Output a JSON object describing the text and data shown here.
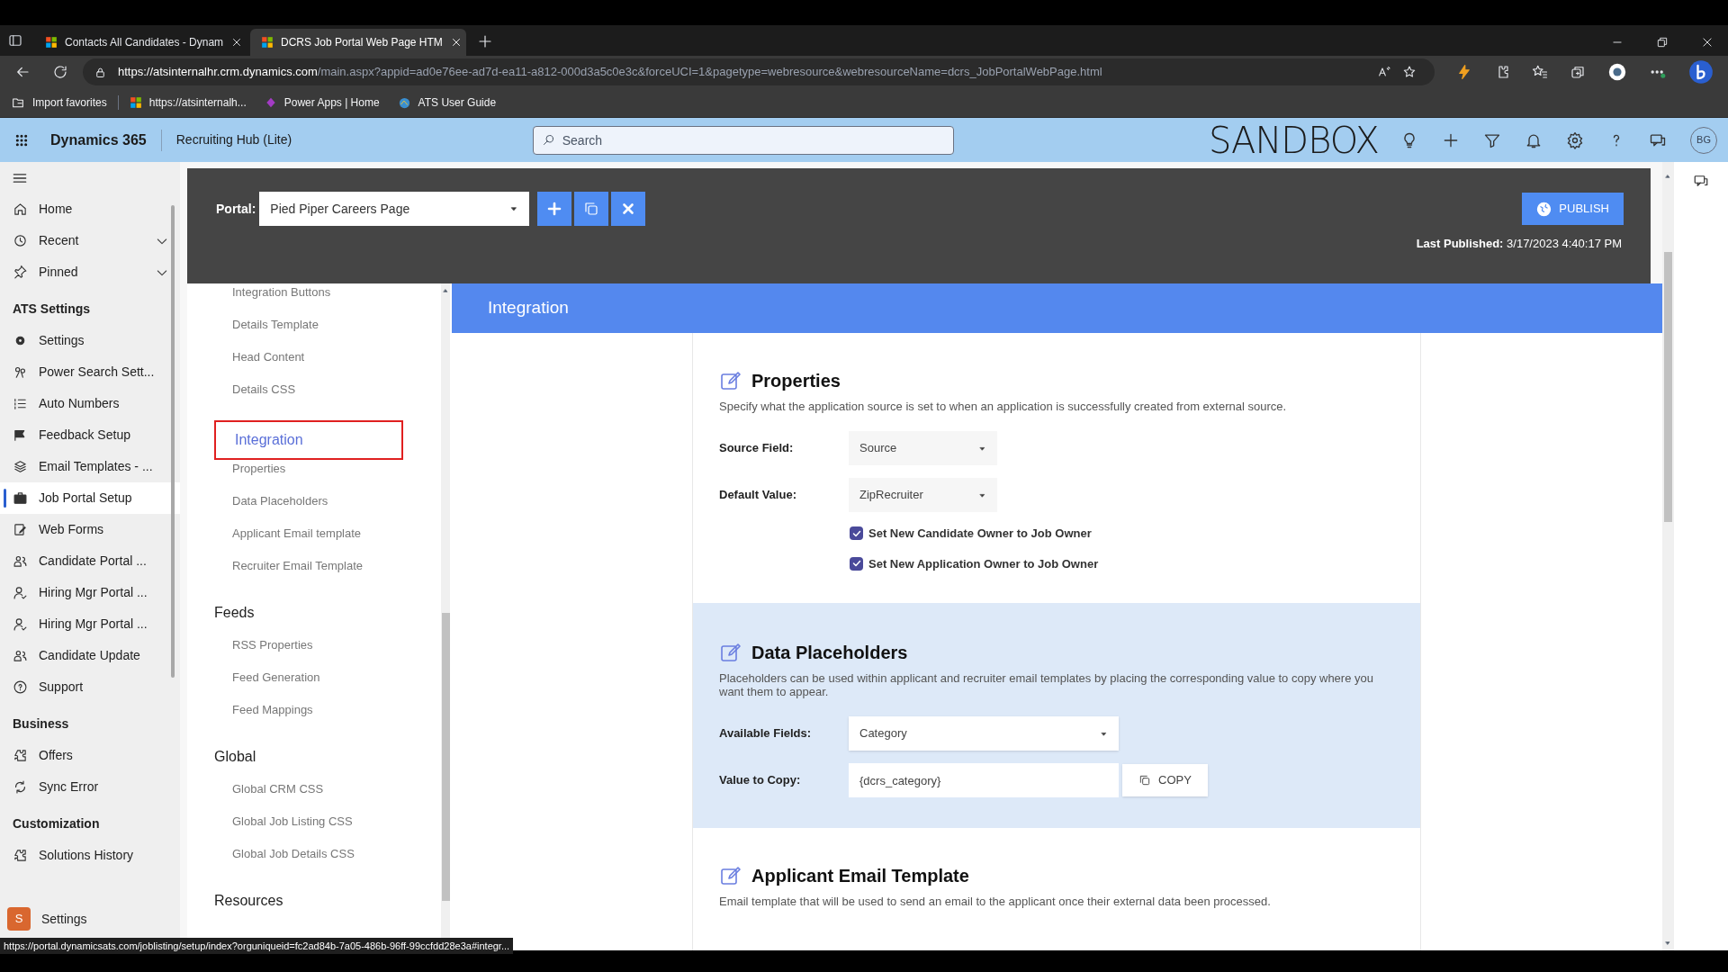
{
  "browser": {
    "tabs": [
      {
        "title": "Contacts All Candidates - Dynam",
        "selected": false
      },
      {
        "title": "DCRS Job Portal Web Page HTM",
        "selected": true
      }
    ],
    "url_host": "https://atsinternalhr.crm.dynamics.com",
    "url_rest": "/main.aspx?appid=ad0e76ee-ad7d-ea11-a812-000d3a5c0e3c&forceUCI=1&pagetype=webresource&webresourceName=dcrs_JobPortalWebPage.html",
    "bookmarks": [
      {
        "label": "Import favorites"
      },
      {
        "label": "https://atsinternalh..."
      },
      {
        "label": "Power Apps | Home"
      },
      {
        "label": "ATS User Guide"
      }
    ],
    "status_url": "https://portal.dynamicsats.com/joblisting/setup/index?orguniqueid=fc2ad84b-7a05-486b-96ff-99ccfdd28e3a#integr..."
  },
  "app_header": {
    "brand": "Dynamics 365",
    "app_name": "Recruiting Hub (Lite)",
    "search_placeholder": "Search",
    "environment": "SANDBOX",
    "avatar": "BG"
  },
  "sidebar": {
    "items": [
      {
        "kind": "item",
        "label": "Home",
        "selected": false,
        "expandable": false
      },
      {
        "kind": "item",
        "label": "Recent",
        "selected": false,
        "expandable": true
      },
      {
        "kind": "item",
        "label": "Pinned",
        "selected": false,
        "expandable": true
      },
      {
        "kind": "heading",
        "label": "ATS Settings"
      },
      {
        "kind": "item",
        "label": "Settings",
        "selected": false,
        "expandable": false
      },
      {
        "kind": "item",
        "label": "Power Search Sett...",
        "selected": false,
        "expandable": false
      },
      {
        "kind": "item",
        "label": "Auto Numbers",
        "selected": false,
        "expandable": false
      },
      {
        "kind": "item",
        "label": "Feedback Setup",
        "selected": false,
        "expandable": false
      },
      {
        "kind": "item",
        "label": "Email Templates - ...",
        "selected": false,
        "expandable": false
      },
      {
        "kind": "item",
        "label": "Job Portal Setup",
        "selected": true,
        "expandable": false
      },
      {
        "kind": "item",
        "label": "Web Forms",
        "selected": false,
        "expandable": false
      },
      {
        "kind": "item",
        "label": "Candidate Portal ...",
        "selected": false,
        "expandable": false
      },
      {
        "kind": "item",
        "label": "Hiring Mgr Portal ...",
        "selected": false,
        "expandable": false
      },
      {
        "kind": "item",
        "label": "Hiring Mgr Portal ...",
        "selected": false,
        "expandable": false
      },
      {
        "kind": "item",
        "label": "Candidate Update",
        "selected": false,
        "expandable": false
      },
      {
        "kind": "item",
        "label": "Support",
        "selected": false,
        "expandable": false
      },
      {
        "kind": "heading",
        "label": "Business"
      },
      {
        "kind": "item",
        "label": "Offers",
        "selected": false,
        "expandable": false
      },
      {
        "kind": "item",
        "label": "Sync Error",
        "selected": false,
        "expandable": false
      },
      {
        "kind": "heading",
        "label": "Customization"
      },
      {
        "kind": "item",
        "label": "Solutions History",
        "selected": false,
        "expandable": false
      }
    ],
    "area": {
      "badge": "S",
      "label": "Settings"
    }
  },
  "portal_bar": {
    "label": "Portal:",
    "value": "Pied Piper Careers Page",
    "publish": "PUBLISH",
    "last_published_label": "Last Published:",
    "last_published_value": "3/17/2023 4:40:17 PM"
  },
  "section_nav": [
    {
      "kind": "sub",
      "label": "Integration Buttons",
      "selected": false
    },
    {
      "kind": "sub",
      "label": "Details Template",
      "selected": false
    },
    {
      "kind": "sub",
      "label": "Head Content",
      "selected": false
    },
    {
      "kind": "sub",
      "label": "Details CSS",
      "selected": false
    },
    {
      "kind": "group",
      "label": "Integration",
      "selected": true
    },
    {
      "kind": "sub",
      "label": "Properties",
      "selected": false
    },
    {
      "kind": "sub",
      "label": "Data Placeholders",
      "selected": false
    },
    {
      "kind": "sub",
      "label": "Applicant Email template",
      "selected": false
    },
    {
      "kind": "sub",
      "label": "Recruiter Email Template",
      "selected": false
    },
    {
      "kind": "group",
      "label": "Feeds",
      "selected": false
    },
    {
      "kind": "sub",
      "label": "RSS Properties",
      "selected": false
    },
    {
      "kind": "sub",
      "label": "Feed Generation",
      "selected": false
    },
    {
      "kind": "sub",
      "label": "Feed Mappings",
      "selected": false
    },
    {
      "kind": "group",
      "label": "Global",
      "selected": false
    },
    {
      "kind": "sub",
      "label": "Global CRM CSS",
      "selected": false
    },
    {
      "kind": "sub",
      "label": "Global Job Listing CSS",
      "selected": false
    },
    {
      "kind": "sub",
      "label": "Global Job Details CSS",
      "selected": false
    },
    {
      "kind": "group",
      "label": "Resources",
      "selected": false
    }
  ],
  "page_title": "Integration",
  "sections": [
    {
      "title": "Properties",
      "description": "Specify what the application source is set to when an application is successfully created from external source.",
      "highlighted": false,
      "rows": [
        {
          "kind": "select",
          "label": "Source Field:",
          "value": "Source"
        },
        {
          "kind": "select",
          "label": "Default Value:",
          "value": "ZipRecruiter"
        },
        {
          "kind": "checkbox",
          "label": "Set New Candidate Owner to Job Owner",
          "checked": true
        },
        {
          "kind": "checkbox",
          "label": "Set New Application Owner to Job Owner",
          "checked": true
        }
      ]
    },
    {
      "title": "Data Placeholders",
      "description": "Placeholders can be used within applicant and recruiter email templates by placing the corresponding value to copy where you want them to appear.",
      "highlighted": true,
      "rows": [
        {
          "kind": "wide_select",
          "label": "Available Fields:",
          "value": "Category"
        },
        {
          "kind": "copy",
          "label": "Value to Copy:",
          "value": "{dcrs_category}",
          "button": "COPY"
        }
      ]
    },
    {
      "title": "Applicant Email Template",
      "description": "Email template that will be used to send an email to the applicant once their external data been processed.",
      "highlighted": false
    }
  ]
}
